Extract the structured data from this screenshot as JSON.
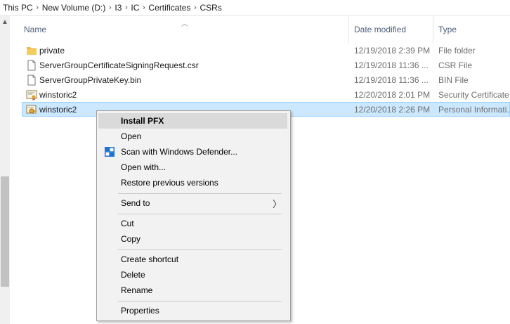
{
  "breadcrumb": [
    "This PC",
    "New Volume (D:)",
    "I3",
    "IC",
    "Certificates",
    "CSRs"
  ],
  "columns": {
    "name": "Name",
    "date": "Date modified",
    "type": "Type"
  },
  "files": [
    {
      "name": "private",
      "date": "12/19/2018 2:39 PM",
      "type": "File folder",
      "icon": "folder-icon"
    },
    {
      "name": "ServerGroupCertificateSigningRequest.csr",
      "date": "12/19/2018 11:36 ...",
      "type": "CSR File",
      "icon": "file-icon"
    },
    {
      "name": "ServerGroupPrivateKey.bin",
      "date": "12/19/2018 11:36 ...",
      "type": "BIN File",
      "icon": "file-icon"
    },
    {
      "name": "winstoric2",
      "date": "12/20/2018 2:01 PM",
      "type": "Security Certificate",
      "icon": "certificate-icon"
    },
    {
      "name": "winstoric2",
      "date": "12/20/2018 2:26 PM",
      "type": "Personal Informati...",
      "icon": "pfx-icon"
    }
  ],
  "context_menu": {
    "install_pfx": "Install PFX",
    "open": "Open",
    "scan": "Scan with Windows Defender...",
    "open_with": "Open with...",
    "restore": "Restore previous versions",
    "send_to": "Send to",
    "cut": "Cut",
    "copy": "Copy",
    "create_shortcut": "Create shortcut",
    "delete": "Delete",
    "rename": "Rename",
    "properties": "Properties"
  },
  "colors": {
    "selection": "#cce8ff",
    "selection_border": "#99d1ff",
    "menu_bg": "#f2f2f2",
    "menu_hover": "#dadada",
    "header_text": "#4c607a",
    "defender_blue": "#1b74d1"
  }
}
